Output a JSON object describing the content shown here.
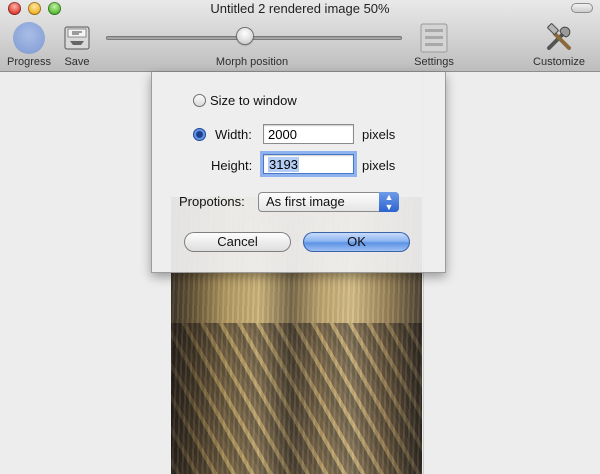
{
  "window": {
    "title": "Untitled 2 rendered image 50%"
  },
  "toolbar": {
    "progress_label": "Progress",
    "save_label": "Save",
    "morph_label": "Morph position",
    "morph_position": 0.47,
    "settings_label": "Settings",
    "customize_label": "Customize"
  },
  "dialog": {
    "size_to_window_label": "Size to window",
    "width_label": "Width:",
    "width_value": "2000",
    "width_unit": "pixels",
    "height_label": "Height:",
    "height_value": "3193",
    "height_unit": "pixels",
    "proportions_label": "Propotions:",
    "proportions_value": "As first image",
    "cancel_label": "Cancel",
    "ok_label": "OK"
  },
  "colors": {
    "accent": "#3f74d8",
    "progress_icon": "#8aa4d8"
  },
  "icons": {
    "progress": "progress-circle-icon",
    "save": "save-icon",
    "settings": "settings-icon",
    "customize": "customize-tools-icon"
  }
}
